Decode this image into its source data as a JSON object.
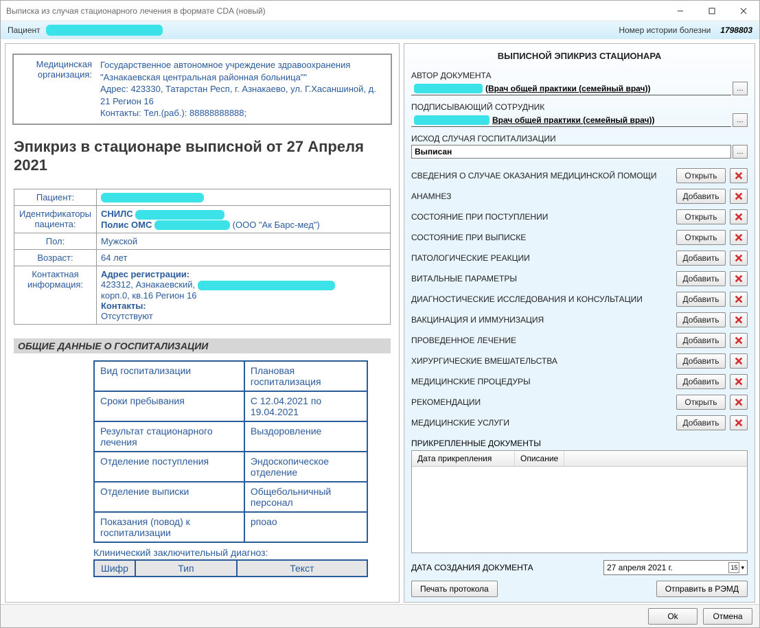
{
  "window": {
    "title": "Выписка из случая стационарного лечения в формате CDA (новый)"
  },
  "header": {
    "patient_label": "Пациент",
    "history_label": "Номер истории болезни",
    "history_number": "1798803"
  },
  "document": {
    "org_label": "Медицинская организация:",
    "org_name": "Государственное автономное учреждение здравоохранения \"Азнакаевская центральная районная больница\"\"",
    "org_address": "Адрес: 423330, Татарстан Респ, г. Азнакаево, ул. Г.Хасаншиной, д. 21 Регион 16",
    "org_contacts": "Контакты: Тел.(раб.): 88888888888;",
    "title": "Эпикриз в стационаре выписной от 27 Апреля 2021",
    "patient": {
      "patient_k": "Пациент:",
      "ids_k": "Идентификаторы пациента:",
      "ids_snils": "СНИЛС",
      "ids_polis_prefix": "Полис ОМС",
      "ids_polis_suffix": "(ООО \"Ак Барс-мед\")",
      "sex_k": "Пол:",
      "sex_v": "Мужской",
      "age_k": "Возраст:",
      "age_v": "64 лет",
      "contact_k": "Контактная информация:",
      "addr_head": "Адрес регистрации:",
      "addr_line1": "423312, Азнакаевский,",
      "addr_line2": "корп.0, кв.16 Регион 16",
      "contacts_head": "Контакты:",
      "contacts_none": "Отсутствуют"
    },
    "hosp_section": "ОБЩИЕ ДАННЫЕ О ГОСПИТАЛИЗАЦИИ",
    "hosp_rows": [
      {
        "k": "Вид госпитализации",
        "v": "Плановая госпитализация"
      },
      {
        "k": "Сроки пребывания",
        "v": "С 12.04.2021 по 19.04.2021"
      },
      {
        "k": "Результат стационарного лечения",
        "v": "Выздоровление"
      },
      {
        "k": "Отделение поступления",
        "v": "Эндоскопическое отделение"
      },
      {
        "k": "Отделение выписки",
        "v": "Общебольничный персонал"
      },
      {
        "k": "Показания (повод) к госпитализации",
        "v": "рпоао"
      }
    ],
    "diag_caption": "Клинический заключительный диагноз:",
    "diag_head": {
      "c1": "Шифр",
      "c2": "Тип",
      "c3": "Текст"
    }
  },
  "right_panel": {
    "title": "ВЫПИСНОЙ ЭПИКРИЗ СТАЦИОНАРА",
    "author_label": "АВТОР ДОКУМЕНТА",
    "author_value": "(Врач общей практики (семейный врач))",
    "signer_label": "ПОДПИСЫВАЮЩИЙ СОТРУДНИК",
    "signer_value": "Врач общей практики (семейный врач))",
    "outcome_label": "ИСХОД СЛУЧАЯ ГОСПИТАЛИЗАЦИИ",
    "outcome_value": "Выписан",
    "actions": {
      "open": "Открыть",
      "add": "Добавить"
    },
    "sections": [
      {
        "label": "СВЕДЕНИЯ О СЛУЧАЕ ОКАЗАНИЯ МЕДИЦИНСКОЙ ПОМОЩИ",
        "btn": "open"
      },
      {
        "label": "АНАМНЕЗ",
        "btn": "add"
      },
      {
        "label": "СОСТОЯНИЕ ПРИ ПОСТУПЛЕНИИ",
        "btn": "open"
      },
      {
        "label": "СОСТОЯНИЕ ПРИ ВЫПИСКЕ",
        "btn": "open"
      },
      {
        "label": "ПАТОЛОГИЧЕСКИЕ РЕАКЦИИ",
        "btn": "add"
      },
      {
        "label": "ВИТАЛЬНЫЕ ПАРАМЕТРЫ",
        "btn": "add"
      },
      {
        "label": "ДИАГНОСТИЧЕСКИЕ ИССЛЕДОВАНИЯ И КОНСУЛЬТАЦИИ",
        "btn": "add"
      },
      {
        "label": "ВАКЦИНАЦИЯ И ИММУНИЗАЦИЯ",
        "btn": "add"
      },
      {
        "label": "ПРОВЕДЕННОЕ ЛЕЧЕНИЕ",
        "btn": "add"
      },
      {
        "label": "ХИРУРГИЧЕСКИЕ ВМЕШАТЕЛЬСТВА",
        "btn": "add"
      },
      {
        "label": "МЕДИЦИНСКИЕ ПРОЦЕДУРЫ",
        "btn": "add"
      },
      {
        "label": "РЕКОМЕНДАЦИИ",
        "btn": "open"
      },
      {
        "label": "МЕДИЦИНСКИЕ УСЛУГИ",
        "btn": "add"
      }
    ],
    "attachments_label": "ПРИКРЕПЛЕННЫЕ ДОКУМЕНТЫ",
    "att_col1": "Дата прикрепления",
    "att_col2": "Описание",
    "date_label": "ДАТА СОЗДАНИЯ ДОКУМЕНТА",
    "date_value": "27  апреля   2021 г.",
    "print_btn": "Печать протокола",
    "send_btn": "Отправить в РЭМД"
  },
  "footer": {
    "ok": "Ok",
    "cancel": "Отмена"
  }
}
